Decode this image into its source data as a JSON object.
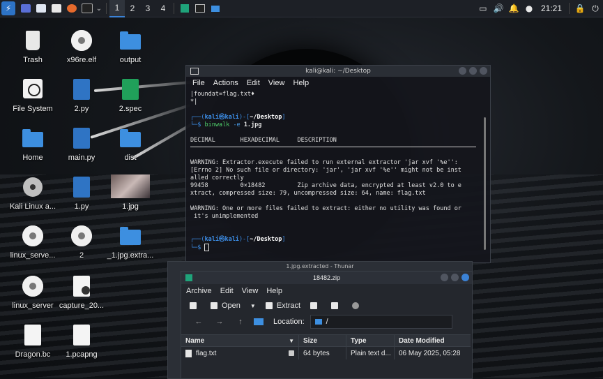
{
  "panel": {
    "workspaces": [
      "1",
      "2",
      "3",
      "4"
    ],
    "active_workspace": "1",
    "clock": "21:21"
  },
  "desktop": {
    "icons": [
      {
        "label": "Trash",
        "kind": "trash"
      },
      {
        "label": "x96re.elf",
        "kind": "gear"
      },
      {
        "label": "output",
        "kind": "folder"
      },
      {
        "label": "File System",
        "kind": "drive"
      },
      {
        "label": "2.py",
        "kind": "py"
      },
      {
        "label": "2.spec",
        "kind": "spec"
      },
      {
        "label": "Home",
        "kind": "folder"
      },
      {
        "label": "main.py",
        "kind": "py"
      },
      {
        "label": "dist",
        "kind": "folder"
      },
      {
        "label": "Kali Linux a...",
        "kind": "disc"
      },
      {
        "label": "1.py",
        "kind": "py"
      },
      {
        "label": "1.jpg",
        "kind": "image"
      },
      {
        "label": "linux_serve...",
        "kind": "gear"
      },
      {
        "label": "2",
        "kind": "gear"
      },
      {
        "label": "_1.jpg.extra...",
        "kind": "folder"
      },
      {
        "label": "linux_server",
        "kind": "gear"
      },
      {
        "label": "capture_20...",
        "kind": "doc"
      },
      {
        "label": "Dragon.bc",
        "kind": "doc"
      },
      {
        "label": "1.pcapng",
        "kind": "doc"
      }
    ]
  },
  "terminal": {
    "title": "kali@kali: ~/Desktop",
    "menu": [
      "File",
      "Actions",
      "Edit",
      "View",
      "Help"
    ],
    "line1": "|foundat=flag.txt♦",
    "line2": "*|",
    "prompt_user": "kali㉿kali",
    "prompt_dir": "~/Desktop",
    "command": "binwalk -e 1.jpg",
    "cmd_name": "binwalk",
    "cmd_args": "-e",
    "cmd_file": "1.jpg",
    "header": "DECIMAL       HEXADECIMAL     DESCRIPTION",
    "warn1": "WARNING: Extractor.execute failed to run external extractor 'jar xvf '%e'':\n[Errno 2] No such file or directory: 'jar', 'jar xvf '%e'' might not be inst\nalled correctly",
    "row": "99458         0×18482         Zip archive data, encrypted at least v2.0 to e\nxtract, compressed size: 79, uncompressed size: 64, name: flag.txt",
    "warn2": "WARNING: One or more files failed to extract: either no utility was found or\n it's unimplemented"
  },
  "thunar": {
    "title": "1.jpg.extracted - Thunar"
  },
  "archive": {
    "title": "18482.zip",
    "menu": [
      "Archive",
      "Edit",
      "View",
      "Help"
    ],
    "open_label": "Open",
    "extract_label": "Extract",
    "location_label": "Location:",
    "location_value": "/",
    "columns": [
      "Name",
      "Size",
      "Type",
      "Date Modified"
    ],
    "rows": [
      {
        "name": "flag.txt",
        "size": "64 bytes",
        "type": "Plain text d...",
        "date": "06 May 2025, 05:28"
      }
    ]
  }
}
